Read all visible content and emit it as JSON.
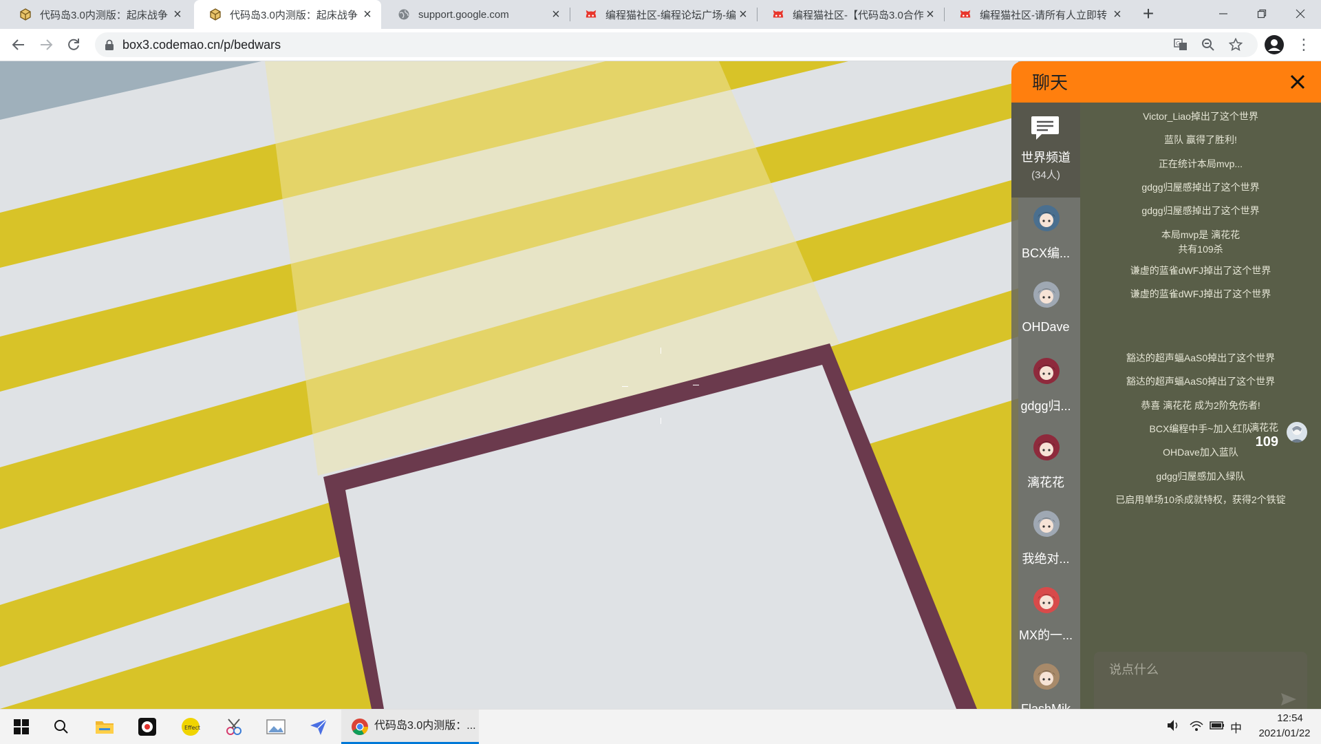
{
  "browser": {
    "tabs": [
      {
        "title": "代码岛3.0内测版：起床战争",
        "active": false,
        "favicon": "box-icon"
      },
      {
        "title": "代码岛3.0内测版：起床战争",
        "active": true,
        "favicon": "box-icon"
      },
      {
        "title": "support.google.com",
        "active": false,
        "favicon": "globe-icon"
      },
      {
        "title": "编程猫社区-编程论坛广场-编",
        "active": false,
        "favicon": "codemao-cat-icon"
      },
      {
        "title": "编程猫社区-【代码岛3.0合作",
        "active": false,
        "favicon": "codemao-cat-icon"
      },
      {
        "title": "编程猫社区-请所有人立即转",
        "active": false,
        "favicon": "codemao-cat-icon"
      }
    ],
    "new_tab_label": "+",
    "url": "box3.codemao.cn/p/bedwars"
  },
  "chat": {
    "title": "聊天",
    "world_channel": {
      "label": "世界频道",
      "count": "(34人)"
    },
    "players": [
      {
        "name": "BCX编...",
        "avatar_color": "#4a6f8f"
      },
      {
        "name": "OHDave",
        "avatar_color": "#9fa8b3"
      },
      {
        "name": "gdgg归...",
        "avatar_color": "#8e2a3c"
      },
      {
        "name": "漓花花",
        "avatar_color": "#8e2a3c"
      },
      {
        "name": "我绝对...",
        "avatar_color": "#9fa8b3"
      },
      {
        "name": "MX的一...",
        "avatar_color": "#d84a4a"
      },
      {
        "name": "FlashMik",
        "avatar_color": "#a88a6a"
      }
    ],
    "messages": [
      {
        "text": "Victor_Liao掉出了这个世界"
      },
      {
        "text": "蓝队 赢得了胜利!"
      },
      {
        "text": "正在统计本局mvp..."
      },
      {
        "text": "gdgg归屋感掉出了这个世界"
      },
      {
        "text": "gdgg归屋感掉出了这个世界"
      },
      {
        "text": "本局mvp是 漓花花",
        "text2": "共有109杀"
      },
      {
        "text": "谦虚的蓝雀dWFJ掉出了这个世界"
      },
      {
        "text": "谦虚的蓝雀dWFJ掉出了这个世界"
      },
      {
        "text": "豁达的超声蝠AaS0掉出了这个世界"
      },
      {
        "text": "豁达的超声蝠AaS0掉出了这个世界"
      },
      {
        "text": "恭喜 漓花花 成为2阶免伤者!"
      },
      {
        "text": "BCX编程中手~加入红队"
      },
      {
        "text": "OHDave加入蓝队"
      },
      {
        "text": "gdgg归屋感加入绿队"
      },
      {
        "text": "已启用单场10杀成就特权，获得2个铁锭"
      }
    ],
    "mvp_bubble": {
      "name": "漓花花",
      "score": "109"
    },
    "input_placeholder": "说点什么",
    "colors": {
      "header": "#ff7f0e"
    }
  },
  "taskbar": {
    "active_window": "代码岛3.0内测版：...",
    "ime": "中",
    "time": "12:54",
    "date": "2021/01/22"
  }
}
